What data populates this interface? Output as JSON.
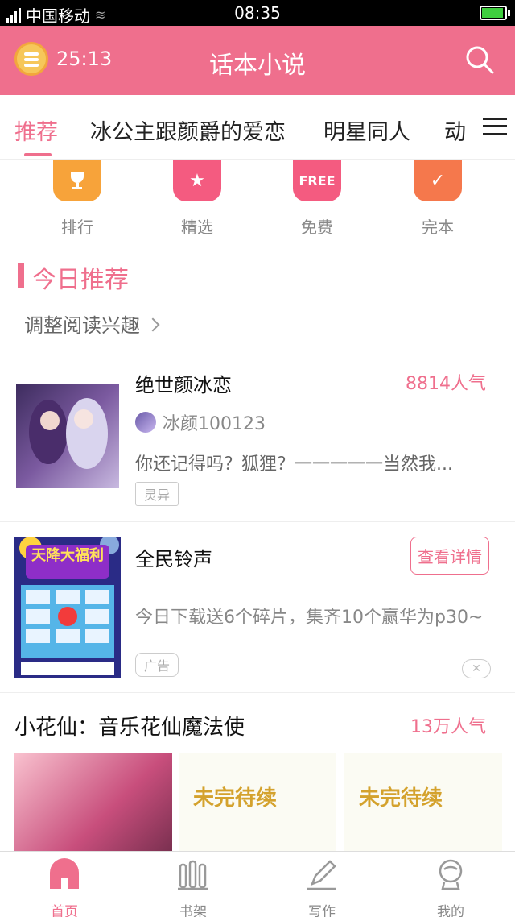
{
  "status_bar": {
    "carrier": "中国移动",
    "time": "08:35"
  },
  "header": {
    "timer": "25:13",
    "title": "话本小说"
  },
  "tabs": [
    {
      "label": "推荐",
      "active": true
    },
    {
      "label": "冰公主跟颜爵的爱恋",
      "active": false
    },
    {
      "label": "明星同人",
      "active": false
    },
    {
      "label": "动漫",
      "active": false
    }
  ],
  "categories": [
    {
      "label": "排行",
      "icon": "trophy-icon",
      "color": "#f7a33a"
    },
    {
      "label": "精选",
      "icon": "star-icon",
      "color": "#f45b80"
    },
    {
      "label": "免费",
      "icon": "free-icon",
      "icon_text": "FREE",
      "color": "#f45b80"
    },
    {
      "label": "完本",
      "icon": "check-icon",
      "color": "#f5784c"
    }
  ],
  "section": {
    "title": "今日推荐",
    "adjust_label": "调整阅读兴趣"
  },
  "book1": {
    "title": "绝世颜冰恋",
    "popularity": "8814人气",
    "author": "冰颜100123",
    "description": "你还记得吗？狐狸？一一一一一当然我...",
    "tag": "灵异"
  },
  "ad": {
    "title": "全民铃声",
    "detail_label": "查看详情",
    "description": "今日下载送6个碎片，集齐10个赢华为p30~",
    "tag": "广告",
    "image_text": "天降大福利"
  },
  "book2": {
    "title": "小花仙：音乐花仙魔法使",
    "popularity": "13万人气",
    "placeholder": "未完待续"
  },
  "nav": [
    {
      "label": "首页",
      "active": true
    },
    {
      "label": "书架",
      "active": false
    },
    {
      "label": "写作",
      "active": false
    },
    {
      "label": "我的",
      "active": false
    }
  ]
}
